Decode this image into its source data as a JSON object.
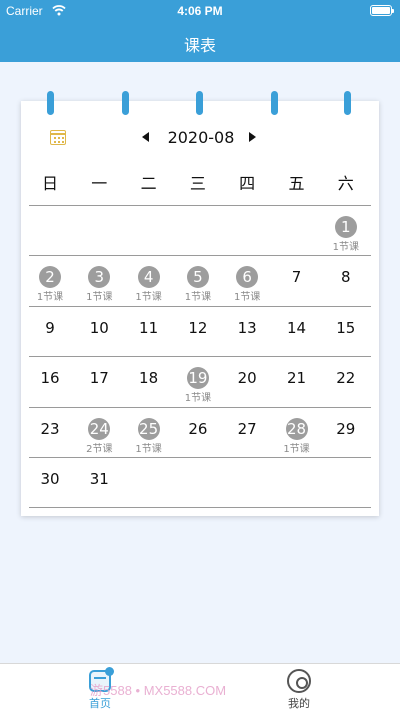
{
  "status_bar": {
    "carrier": "Carrier",
    "time": "4:06 PM"
  },
  "header": {
    "title": "课表"
  },
  "calendar": {
    "month": "2020-08",
    "weekdays": [
      "日",
      "一",
      "二",
      "三",
      "四",
      "五",
      "六"
    ],
    "days": [
      {
        "day": "1",
        "lessons": "1节课"
      },
      {
        "day": "2",
        "lessons": "1节课"
      },
      {
        "day": "3",
        "lessons": "1节课"
      },
      {
        "day": "4",
        "lessons": "1节课"
      },
      {
        "day": "5",
        "lessons": "1节课"
      },
      {
        "day": "6",
        "lessons": "1节课"
      },
      {
        "day": "7",
        "lessons": ""
      },
      {
        "day": "8",
        "lessons": ""
      },
      {
        "day": "9",
        "lessons": ""
      },
      {
        "day": "10",
        "lessons": ""
      },
      {
        "day": "11",
        "lessons": ""
      },
      {
        "day": "12",
        "lessons": ""
      },
      {
        "day": "13",
        "lessons": ""
      },
      {
        "day": "14",
        "lessons": ""
      },
      {
        "day": "15",
        "lessons": ""
      },
      {
        "day": "16",
        "lessons": ""
      },
      {
        "day": "17",
        "lessons": ""
      },
      {
        "day": "18",
        "lessons": ""
      },
      {
        "day": "19",
        "lessons": "1节课"
      },
      {
        "day": "20",
        "lessons": ""
      },
      {
        "day": "21",
        "lessons": ""
      },
      {
        "day": "22",
        "lessons": ""
      },
      {
        "day": "23",
        "lessons": ""
      },
      {
        "day": "24",
        "lessons": "2节课"
      },
      {
        "day": "25",
        "lessons": "1节课"
      },
      {
        "day": "26",
        "lessons": ""
      },
      {
        "day": "27",
        "lessons": ""
      },
      {
        "day": "28",
        "lessons": "1节课"
      },
      {
        "day": "29",
        "lessons": ""
      },
      {
        "day": "30",
        "lessons": ""
      },
      {
        "day": "31",
        "lessons": ""
      }
    ]
  },
  "tab_bar": {
    "home_label": "首页",
    "mine_label": "我的"
  },
  "watermark": "游5588 • MX5588.COM",
  "colors": {
    "accent": "#3a9fd8",
    "lesson_day": "#9d9d9d",
    "calendar_icon": "#e0b84a"
  },
  "icons": [
    "wifi-icon",
    "battery-icon",
    "calendar-icon",
    "prev-month-icon",
    "next-month-icon",
    "home-tab-icon",
    "mine-tab-icon"
  ]
}
